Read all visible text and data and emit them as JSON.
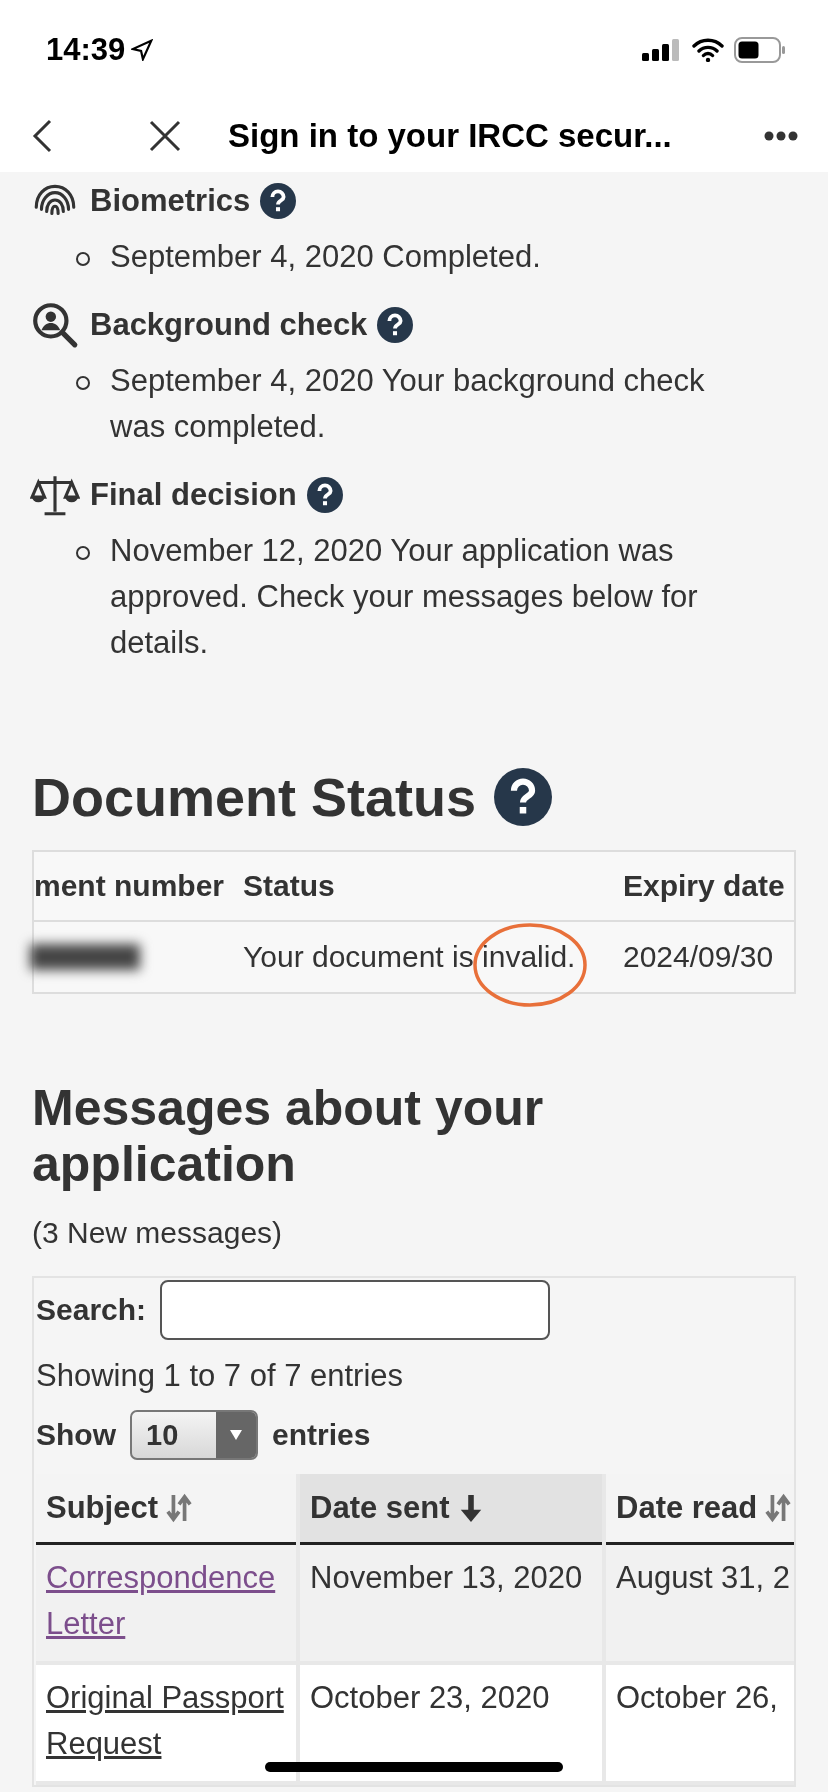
{
  "status_bar": {
    "time": "14:39"
  },
  "nav": {
    "title": "Sign in to your IRCC secur..."
  },
  "steps": [
    {
      "kind": "fingerprint",
      "title": "Biometrics",
      "items": [
        "September 4, 2020 Completed."
      ]
    },
    {
      "kind": "background",
      "title": "Background check",
      "items": [
        "September 4, 2020 Your background check was completed."
      ]
    },
    {
      "kind": "scales",
      "title": "Final decision",
      "items": [
        "November 12, 2020 Your application was approved. Check your messages below for details."
      ]
    }
  ],
  "document_status": {
    "title": "Document Status",
    "columns": [
      "ment number",
      "Status",
      "Expiry date"
    ],
    "rows": [
      {
        "status": "Your document is invalid.",
        "annotated": true,
        "expiry": "2024/09/30"
      }
    ]
  },
  "messages": {
    "title": "Messages about your application",
    "count": "(3 New messages)",
    "search_label": "Search:",
    "info": "Showing 1 to 7 of 7 entries",
    "show_label": "Show",
    "page_size": "10",
    "entries_label": "entries",
    "columns": [
      {
        "label": "Subject",
        "sorted": false
      },
      {
        "label": "Date sent",
        "sorted": true
      },
      {
        "label": "Date read",
        "sorted": false
      }
    ],
    "rows": [
      {
        "subject": "Correspondence Letter",
        "visited": true,
        "date_sent": "November 13, 2020",
        "date_read": "August 31, 2"
      },
      {
        "subject": "Original Passport Request",
        "visited": false,
        "date_sent": "October 23, 2020",
        "date_read": "October 26,"
      }
    ]
  }
}
